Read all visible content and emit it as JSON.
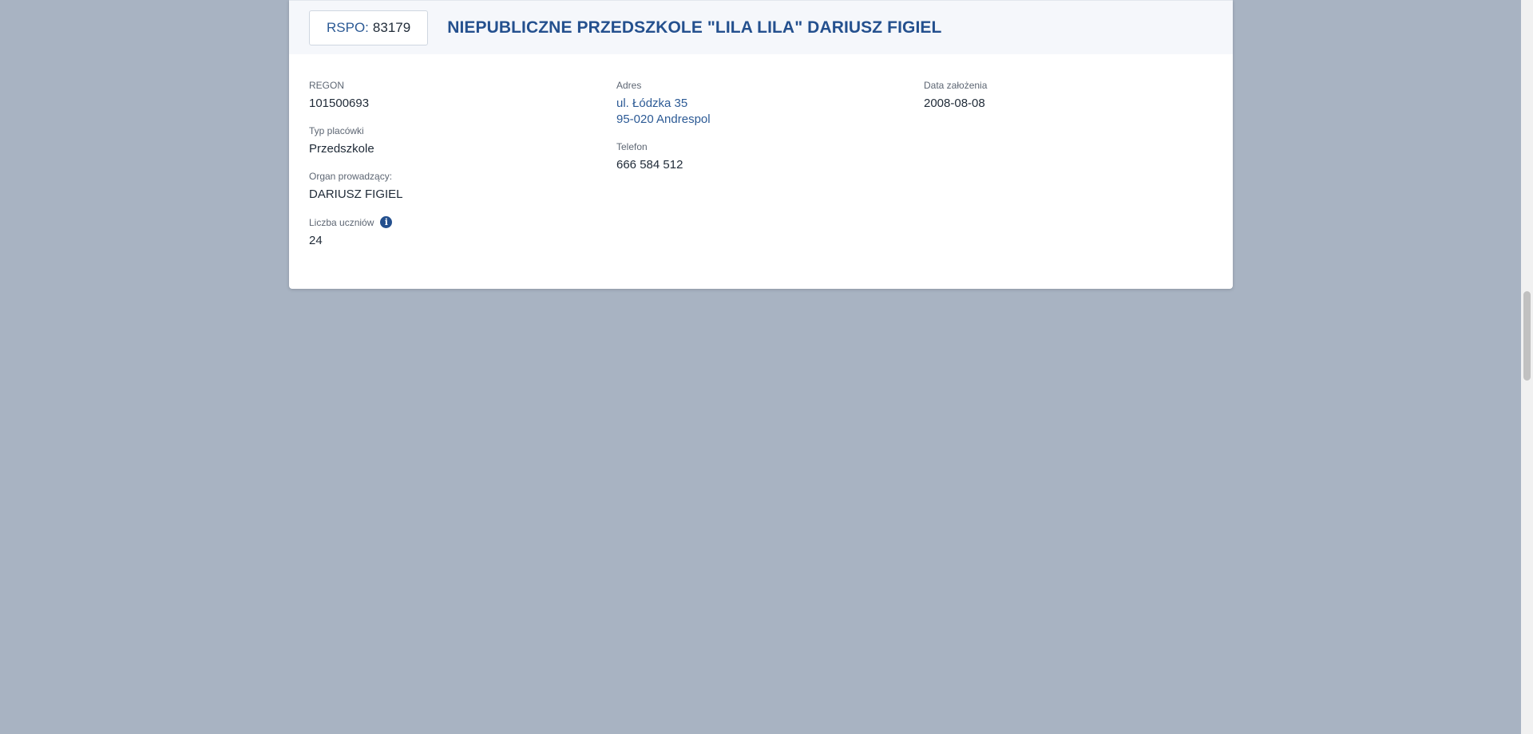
{
  "header": {
    "rspo_label": "RSPO:",
    "rspo_value": "83179",
    "title": "NIEPUBLICZNE PRZEDSZKOLE \"LILA LILA\" DARIUSZ FIGIEL"
  },
  "details": {
    "regon": {
      "label": "REGON",
      "value": "101500693"
    },
    "type": {
      "label": "Typ placówki",
      "value": "Przedszkole"
    },
    "organ": {
      "label": "Organ prowadzący:",
      "value": "DARIUSZ FIGIEL"
    },
    "students": {
      "label": "Liczba uczniów",
      "value": "24",
      "icon": "info-icon"
    },
    "address": {
      "label": "Adres",
      "line1": "ul. Łódzka 35",
      "line2": "95-020 Andrespol"
    },
    "phone": {
      "label": "Telefon",
      "value": "666 584 512"
    },
    "founded": {
      "label": "Data założenia",
      "value": "2008-08-08"
    }
  },
  "colors": {
    "background": "#a8b3c2",
    "accent": "#24508e",
    "link": "#2c5a95"
  }
}
